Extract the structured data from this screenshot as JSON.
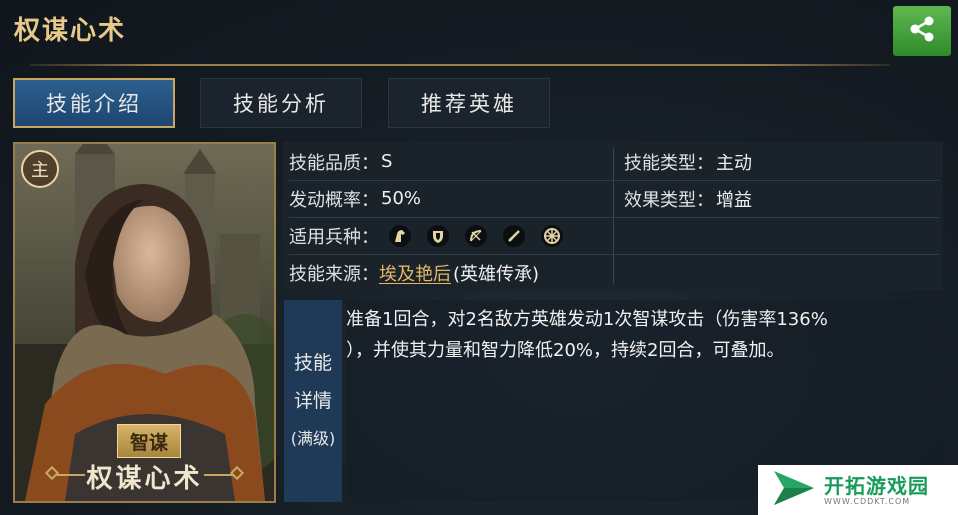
{
  "header": {
    "title": "权谋心术"
  },
  "tabs": [
    {
      "label": "技能介绍",
      "active": true
    },
    {
      "label": "技能分析",
      "active": false
    },
    {
      "label": "推荐英雄",
      "active": false
    }
  ],
  "portrait": {
    "role_badge": "主",
    "type_badge": "智谋",
    "name": "权谋心术"
  },
  "info": {
    "quality_label": "技能品质：",
    "quality_value": "S",
    "type_label": "技能类型：",
    "type_value": "主动",
    "rate_label": "发动概率：",
    "rate_value": "50%",
    "effect_label": "效果类型：",
    "effect_value": "增益",
    "troops_label": "适用兵种：",
    "troop_icons": [
      "cavalry-icon",
      "shield-icon",
      "bow-icon",
      "sword-icon",
      "wheel-icon"
    ],
    "source_label": "技能来源：",
    "source_link": "埃及艳后",
    "source_suffix": "(英雄传承)"
  },
  "detail": {
    "label_line1": "技能",
    "label_line2": "详情",
    "label_line3": "(满级)",
    "text_line1": "准备1回合，对2名敌方英雄发动1次智谋攻击（伤害率136%",
    "text_line2": "），并使其力量和智力降低20%，持续2回合，可叠加。"
  },
  "watermark": {
    "name": "开拓游戏园",
    "url": "WWW.CDDKT.COM"
  },
  "colors": {
    "accent_gold": "#e8c98a",
    "tab_active": "#2d5f8e",
    "share_green": "#4caf45"
  }
}
